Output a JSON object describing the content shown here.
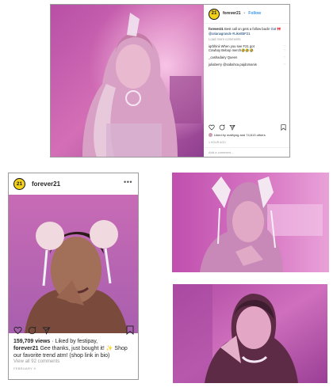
{
  "desktop_post": {
    "logo_text": "21",
    "username": "forever21",
    "dot": "•",
    "follow_label": "Follow",
    "caption_user": "forever21",
    "caption_text": "Best call on gets a follow back!",
    "caption_tags": "Got 🎀 @arianagrande #LikeItBF21",
    "load_more": "Load more comments",
    "comments": [
      "iqrbhinii When you see F21 got",
      "Cowboy Bebop merch🤣🤣🤣",
      "_cashadairy Queen",
      "juliaberry @sabahca.pajdomanis"
    ],
    "heart_icon": "♡",
    "liked_by": "Liked by mathyng and 74,613 others",
    "time": "1 HOUR AGO",
    "add_comment": "Add a comment..."
  },
  "mobile_post": {
    "logo_text": "21",
    "username": "forever21",
    "more": "•••",
    "views_count": "159,709 views",
    "views_rest": " · Liked by festipay,",
    "caption_user": "forever21",
    "caption_text": " Gee thanks, just bought it! ✨ Shop our favorite trend atm! (shop link in bio)",
    "view_all": "View all 92 comments",
    "date": "FEBRUARY 9"
  },
  "colors": {
    "brand_yellow": "#f2d11b",
    "photo_pink": "#c24fa8",
    "link_blue": "#3897f0"
  }
}
